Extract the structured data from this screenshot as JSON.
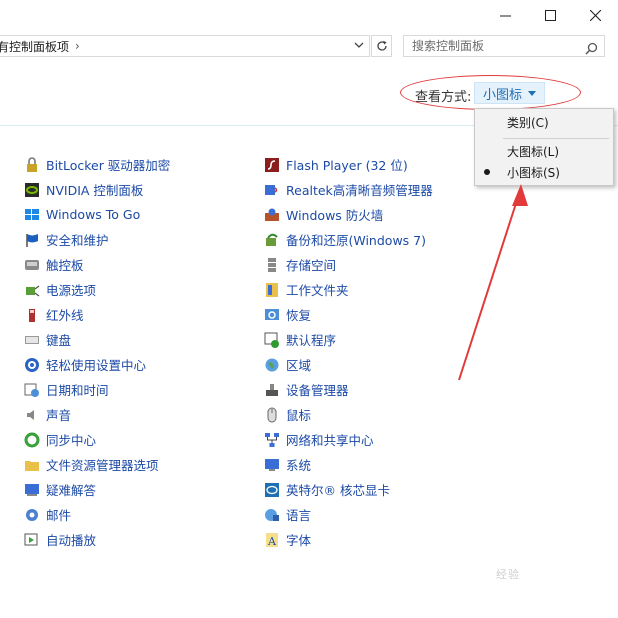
{
  "window": {
    "minimize_label": "",
    "maximize_label": "",
    "close_label": ""
  },
  "address_bar": {
    "path": "有控制面板项",
    "separator": "›"
  },
  "search": {
    "placeholder": "搜索控制面板"
  },
  "view_by": {
    "label": "查看方式:",
    "selected": "小图标"
  },
  "view_menu": {
    "items": [
      {
        "label": "类别(C)",
        "checked": false
      },
      {
        "label": "大图标(L)",
        "checked": false
      },
      {
        "label": "小图标(S)",
        "checked": true
      }
    ]
  },
  "items_left": [
    {
      "label": "BitLocker 驱动器加密",
      "icon": "bitlocker-icon"
    },
    {
      "label": "NVIDIA 控制面板",
      "icon": "nvidia-icon"
    },
    {
      "label": "Windows To Go",
      "icon": "windows-to-go-icon"
    },
    {
      "label": "安全和维护",
      "icon": "flag-icon"
    },
    {
      "label": "触控板",
      "icon": "touchpad-icon"
    },
    {
      "label": "电源选项",
      "icon": "power-icon"
    },
    {
      "label": "红外线",
      "icon": "infrared-icon"
    },
    {
      "label": "键盘",
      "icon": "keyboard-icon"
    },
    {
      "label": "轻松使用设置中心",
      "icon": "ease-of-access-icon"
    },
    {
      "label": "日期和时间",
      "icon": "calendar-clock-icon"
    },
    {
      "label": "声音",
      "icon": "speaker-icon"
    },
    {
      "label": "同步中心",
      "icon": "sync-icon"
    },
    {
      "label": "文件资源管理器选项",
      "icon": "folder-icon"
    },
    {
      "label": "疑难解答",
      "icon": "troubleshoot-icon"
    },
    {
      "label": "邮件",
      "icon": "mail-icon"
    },
    {
      "label": "自动播放",
      "icon": "autoplay-icon"
    }
  ],
  "items_right": [
    {
      "label": "Flash Player (32 位)",
      "icon": "flash-icon"
    },
    {
      "label": "Realtek高清晰音频管理器",
      "icon": "realtek-icon"
    },
    {
      "label": "Windows 防火墙",
      "icon": "firewall-icon"
    },
    {
      "label": "备份和还原(Windows 7)",
      "icon": "backup-icon"
    },
    {
      "label": "存储空间",
      "icon": "storage-icon"
    },
    {
      "label": "工作文件夹",
      "icon": "work-folders-icon"
    },
    {
      "label": "恢复",
      "icon": "recovery-icon"
    },
    {
      "label": "默认程序",
      "icon": "default-programs-icon"
    },
    {
      "label": "区域",
      "icon": "globe-icon"
    },
    {
      "label": "设备管理器",
      "icon": "device-manager-icon"
    },
    {
      "label": "鼠标",
      "icon": "mouse-icon"
    },
    {
      "label": "网络和共享中心",
      "icon": "network-icon"
    },
    {
      "label": "系统",
      "icon": "system-monitor-icon"
    },
    {
      "label": "英特尔® 核芯显卡",
      "icon": "intel-graphics-icon"
    },
    {
      "label": "语言",
      "icon": "language-icon"
    },
    {
      "label": "字体",
      "icon": "font-icon"
    }
  ],
  "watermark": "经验"
}
